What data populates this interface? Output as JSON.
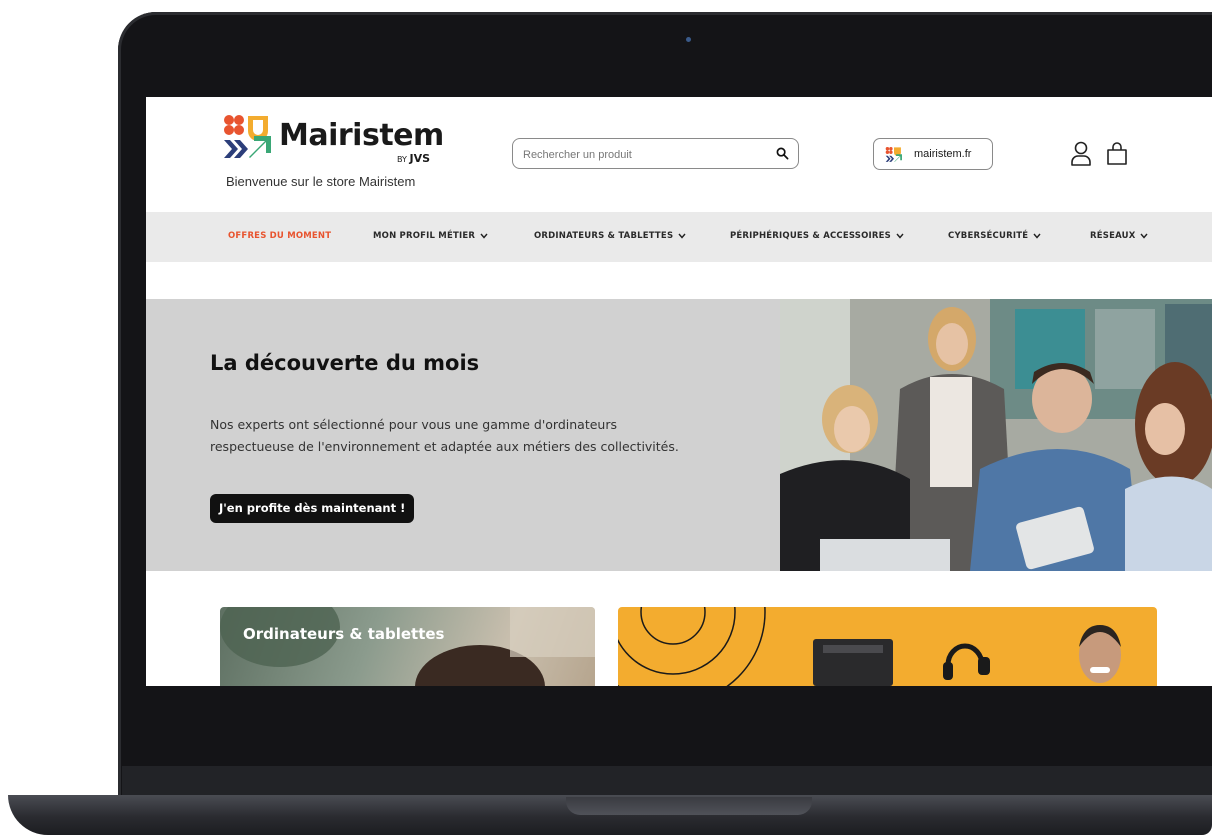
{
  "colors": {
    "brand_orange": "#e8542f",
    "promo_banner": "#f3ac2f",
    "hero_panel": "#d1d1d1",
    "nav_bar": "#eaeaea",
    "cta_bg": "#111111"
  },
  "header": {
    "logo_name": "Mairistem",
    "logo_by": "BY",
    "logo_jvs": "JVS",
    "welcome": "Bienvenue sur le store Mairistem",
    "search_placeholder": "Rechercher un produit",
    "site_link": "mairistem.fr",
    "icons": [
      "search-icon",
      "account-icon",
      "cart-icon"
    ]
  },
  "nav": {
    "items": [
      {
        "label": "OFFRES DU MOMENT",
        "has_dropdown": false
      },
      {
        "label": "MON PROFIL MÉTIER",
        "has_dropdown": true
      },
      {
        "label": "ORDINATEURS & TABLETTES",
        "has_dropdown": true
      },
      {
        "label": "PÉRIPHÉRIQUES & ACCESSOIRES",
        "has_dropdown": true
      },
      {
        "label": "CYBERSÉCURITÉ",
        "has_dropdown": true
      },
      {
        "label": "RÉSEAUX",
        "has_dropdown": true
      }
    ]
  },
  "hero": {
    "title": "La découverte du mois",
    "desc_line1": "Nos experts ont sélectionné pour vous une gamme d'ordinateurs",
    "desc_line2": "respectueuse de l'environnement et adaptée aux métiers des collectivités.",
    "cta": "J'en profite dès maintenant !"
  },
  "cards": {
    "left_title": "Ordinateurs & tablettes"
  }
}
